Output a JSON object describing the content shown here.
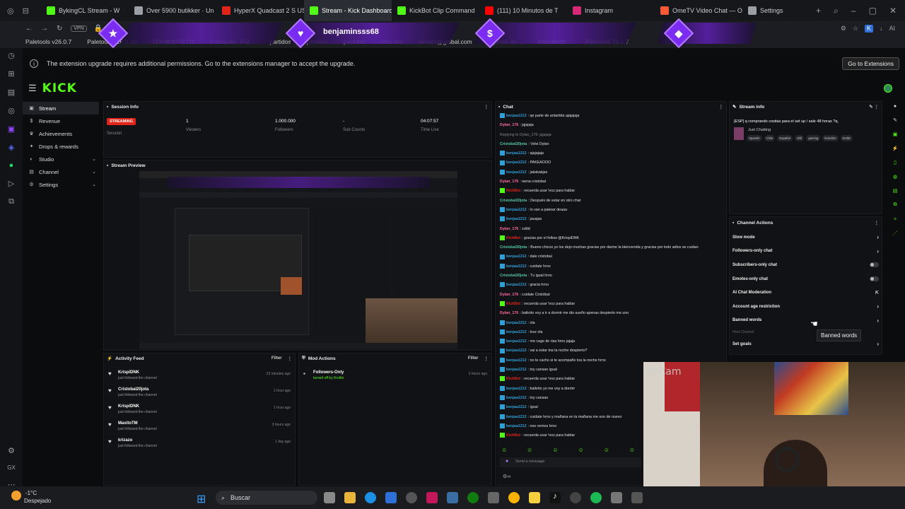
{
  "browser": {
    "tabs": [
      {
        "label": "BykingCL Stream - W",
        "icon": "kick-icon",
        "color": "#53fc18"
      },
      {
        "label": "Over 5900 butikker · Un",
        "icon": "link-icon",
        "color": "#9aa0a6"
      },
      {
        "label": "HyperX Quadcast 2 S US",
        "icon": "hyperx-icon",
        "color": "#e1251b"
      },
      {
        "label": "Stream - Kick Dashboard",
        "icon": "kick-icon",
        "color": "#53fc18"
      },
      {
        "label": "KickBot Clip Command",
        "icon": "kick-icon",
        "color": "#53fc18"
      },
      {
        "label": "(111) 10 Minutos de T",
        "icon": "youtube-icon",
        "color": "#ff0000"
      },
      {
        "label": "Instagram",
        "icon": "instagram-icon",
        "color": "#d62976"
      },
      {
        "label": "OmeTV Video Chat — Or",
        "icon": "ometv-icon",
        "color": "#ff5a36"
      },
      {
        "label": "Settings",
        "icon": "gear-icon",
        "color": "#9aa0a6"
      }
    ],
    "vpn_label": "VPN",
    "bookmarks": [
      "Paletools v26.0.7",
      "Paletools v26.0.10",
      "110+909741711",
      "Paletools · Pal...",
      "partidos",
      "partidos",
      "partidos",
      "chat voz",
      "stream@global.com",
      "Agenda de...",
      "Webskedit...",
      "Paletools 25.1.7"
    ],
    "extension_banner": {
      "text": "The extension upgrade requires additional permissions. Go to the extensions manager to accept the upgrade.",
      "button": "Go to Extensions"
    },
    "alert_overlay_name": "benjaminsss68"
  },
  "kick": {
    "logo": "KICK",
    "nav": [
      {
        "label": "Stream",
        "icon": "stream-icon",
        "active": true,
        "expandable": false
      },
      {
        "label": "Revenue",
        "icon": "revenue-icon",
        "active": false,
        "expandable": false
      },
      {
        "label": "Achievements",
        "icon": "trophy-icon",
        "active": false,
        "expandable": false
      },
      {
        "label": "Drops & rewards",
        "icon": "gift-icon",
        "active": false,
        "expandable": false
      },
      {
        "label": "Studio",
        "icon": "studio-icon",
        "active": false,
        "expandable": true
      },
      {
        "label": "Channel",
        "icon": "channel-icon",
        "active": false,
        "expandable": true
      },
      {
        "label": "Settings",
        "icon": "gear-icon",
        "active": false,
        "expandable": true
      }
    ],
    "session": {
      "title": "Session Info",
      "badge": "STREAMING",
      "session_label": "Session",
      "stats": [
        {
          "value": "1",
          "label": "Viewers"
        },
        {
          "value": "1.000.000",
          "label": "Followers"
        },
        {
          "value": "-",
          "label": "Sub Counts"
        },
        {
          "value": "04:07:57",
          "label": "Time Live"
        }
      ]
    },
    "preview": {
      "title": "Stream Preview"
    },
    "activity": {
      "title": "Activity Feed",
      "filter": "Filter",
      "items": [
        {
          "user": "KrispiDNK",
          "action": "just followed the channel",
          "time": "22 minutes ago"
        },
        {
          "user": "Cristobal20jota",
          "action": "just followed the channel",
          "time": "1 hour ago"
        },
        {
          "user": "KrispiDNK",
          "action": "just followed the channel",
          "time": "1 hour ago"
        },
        {
          "user": "MaxitoTM",
          "action": "just followed the channel",
          "time": "3 hours ago"
        },
        {
          "user": "krizazo",
          "action": "just followed the channel",
          "time": "1 day ago"
        }
      ]
    },
    "mod_actions": {
      "title": "Mod Actions",
      "filter": "Filter",
      "items": [
        {
          "action": "Followers-Only",
          "detail": "turned off by Kroittz",
          "time": "3 hours ago"
        }
      ]
    },
    "chat": {
      "title": "Chat",
      "input_placeholder": "Send a message",
      "messages": [
        {
          "user": "benjaa1212",
          "color": "#2f9fd8",
          "text": "qe parte de antartida ajajajaja",
          "badge": true
        },
        {
          "user": "Dylan_176",
          "color": "#ff6b9a",
          "text": "jqjajaja",
          "badge": false
        },
        {
          "user": "",
          "color": "#888888",
          "text": "Replying to Dylan_176: jqjajaja",
          "badge": false
        },
        {
          "user": "Cristobal20jota",
          "color": "#53c7a0",
          "text": "Volvi Dylan",
          "badge": false
        },
        {
          "user": "benjaa1212",
          "color": "#2f9fd8",
          "text": "ajajajaja",
          "badge": true
        },
        {
          "user": "benjaa1212",
          "color": "#2f9fd8",
          "text": "PAKEAOOO",
          "badge": true
        },
        {
          "user": "benjaa1212",
          "color": "#2f9fd8",
          "text": "jakakakjas",
          "badge": true
        },
        {
          "user": "Dylan_176",
          "color": "#ff6b9a",
          "text": "wena cristobal",
          "badge": false
        },
        {
          "user": "KickBot",
          "color": "#e1251b",
          "text": "recuerda usar !voz para hablar",
          "badge": true
        },
        {
          "user": "Cristobal20jota",
          "color": "#53c7a0",
          "text": "Después de estar en otro chat",
          "badge": false
        },
        {
          "user": "benjaa1212",
          "color": "#2f9fd8",
          "text": "lo van a pakear deaaa",
          "badge": true
        },
        {
          "user": "benjaa1212",
          "color": "#2f9fd8",
          "text": "jauajas",
          "badge": true
        },
        {
          "user": "Dylan_176",
          "color": "#ff6b9a",
          "text": "xddd",
          "badge": false
        },
        {
          "user": "KickBot",
          "color": "#e1251b",
          "text": "gracias por el follow @KrispiDNK",
          "badge": true
        },
        {
          "user": "Cristobal20jota",
          "color": "#53c7a0",
          "text": "Bueno chicos yo los dejo muchas gracias por darme la bienvenida y gracias por todo adios se cuidan",
          "badge": false
        },
        {
          "user": "benjaa1212",
          "color": "#2f9fd8",
          "text": "dale cristobal",
          "badge": true
        },
        {
          "user": "benjaa1212",
          "color": "#2f9fd8",
          "text": "cuidate hrno",
          "badge": true
        },
        {
          "user": "Cristobal20jota",
          "color": "#53c7a0",
          "text": "Tu igual hrno",
          "badge": false
        },
        {
          "user": "benjaa1212",
          "color": "#2f9fd8",
          "text": "gracia hrno",
          "badge": true
        },
        {
          "user": "Dylan_176",
          "color": "#ff6b9a",
          "text": "cuidate Cristóbal",
          "badge": false
        },
        {
          "user": "KickBot",
          "color": "#e1251b",
          "text": "recuerda usar !voz para hablar",
          "badge": true
        },
        {
          "user": "Dylan_176",
          "color": "#ff6b9a",
          "text": "balkrito voy a ir a dormir me dio sueño apenas despierto me uno",
          "badge": false
        },
        {
          "user": "benjaa1212",
          "color": "#2f9fd8",
          "text": "ola",
          "badge": true
        },
        {
          "user": "benjaa1212",
          "color": "#2f9fd8",
          "text": "txxz ola",
          "badge": true
        },
        {
          "user": "benjaa1212",
          "color": "#2f9fd8",
          "text": "me cage de risa hrno jajaja",
          "badge": true
        },
        {
          "user": "benjaa1212",
          "color": "#2f9fd8",
          "text": "vai a estar toa la noche despierto?",
          "badge": true
        },
        {
          "user": "benjaa1212",
          "color": "#2f9fd8",
          "text": "no te cacho si te acompañe toa la noche hrno",
          "badge": true
        },
        {
          "user": "benjaa1212",
          "color": "#2f9fd8",
          "text": "toy cansao igual",
          "badge": true
        },
        {
          "user": "KickBot",
          "color": "#e1251b",
          "text": "recuerda usar !voz para hablar",
          "badge": true
        },
        {
          "user": "benjaa1212",
          "color": "#2f9fd8",
          "text": "balkrito yo me voy a dormir",
          "badge": true
        },
        {
          "user": "benjaa1212",
          "color": "#2f9fd8",
          "text": "toy cansao",
          "badge": true
        },
        {
          "user": "benjaa1212",
          "color": "#2f9fd8",
          "text": "igual",
          "badge": true
        },
        {
          "user": "benjaa1212",
          "color": "#2f9fd8",
          "text": "cuidate hrno y mañana en la mañana me uno de nuevo",
          "badge": true
        },
        {
          "user": "benjaa1212",
          "color": "#2f9fd8",
          "text": "nos vemos hrno",
          "badge": true
        },
        {
          "user": "KickBot",
          "color": "#e1251b",
          "text": "recuerda usar !voz para hablar",
          "badge": true
        }
      ]
    },
    "stream_info": {
      "title": "Stream info",
      "stream_title": "[ESP] q comprando cositas para el set up / sale 48 horas ?q,",
      "category": "Just Chatting",
      "tags": [
        "Spanish",
        "Chile",
        "Español",
        "chill",
        "gaming",
        "kickchile",
        "krolttz"
      ]
    },
    "channel_actions": {
      "title": "Channel Actions",
      "items": [
        {
          "label": "Slow mode",
          "control": "arrow"
        },
        {
          "label": "Followers-only chat",
          "control": "arrow"
        },
        {
          "label": "Subscribers-only chat",
          "control": "toggle"
        },
        {
          "label": "Emotes-only chat",
          "control": "toggle"
        },
        {
          "label": "AI Chat Moderation",
          "control": "link"
        },
        {
          "label": "Account age restriction",
          "control": "arrow"
        },
        {
          "label": "Banned words",
          "control": "arrow"
        },
        {
          "label": "Host Channel",
          "control": "none"
        },
        {
          "label": "Set goals",
          "control": "arrow"
        }
      ],
      "tooltip": "Banned words"
    }
  },
  "webcam_label": "iVCam",
  "taskbar": {
    "temperature": "-1°C",
    "weather": "Despejado",
    "search_placeholder": "Buscar"
  },
  "colors": {
    "kick_green": "#53fc18",
    "streaming_red": "#e1251b",
    "overlay_purple": "#7a2cf0"
  }
}
